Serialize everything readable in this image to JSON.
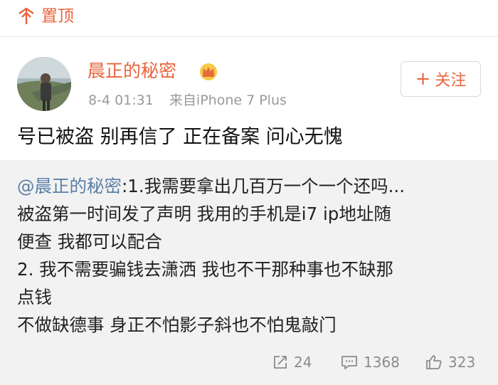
{
  "pin": {
    "label": "置顶",
    "icon": "pin-icon"
  },
  "post": {
    "author": "晨正的秘密",
    "badge_icon": "crown-icon",
    "time": "8-4 01:31",
    "source": "来自iPhone 7 Plus",
    "follow_label": "关注",
    "text": "号已被盗 别再信了 正在备案 问心无愧"
  },
  "repost": {
    "mention": "@晨正的秘密",
    "lines": [
      ":1.我需要拿出几百万一个一个还吗...",
      "被盗第一时间发了声明 我用的手机是i7 ip地址随",
      "便查 我都可以配合",
      "2. 我不需要骗钱去潇洒 我也不干那种事也不缺那",
      "点钱",
      "不做缺德事 身正不怕影子斜也不怕鬼敲门"
    ],
    "actions": {
      "reposts": "24",
      "comments": "1368",
      "likes": "323"
    }
  },
  "colors": {
    "accent": "#e8643e",
    "mention": "#5b7fa6",
    "repost_bg": "#f2f2f2"
  }
}
